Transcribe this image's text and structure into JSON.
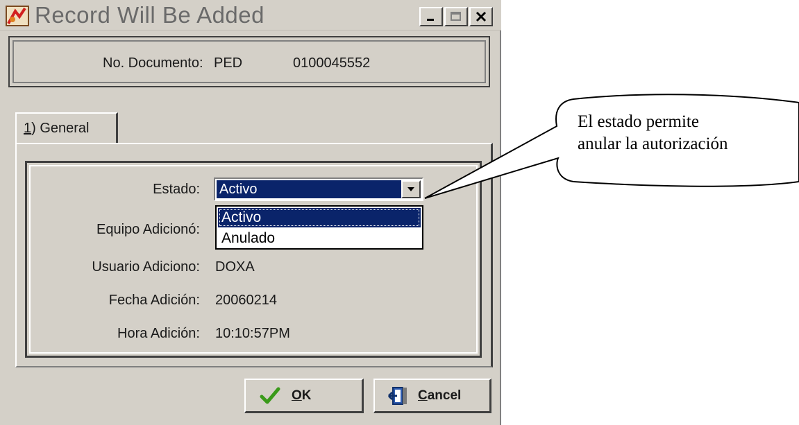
{
  "window": {
    "title": "Record Will Be Added"
  },
  "document": {
    "label": "No. Documento:",
    "prefix": "PED",
    "number": "0100045552"
  },
  "tabs": [
    {
      "mnemonic": "1",
      "rest": ") General",
      "active": true
    }
  ],
  "fields": {
    "estado": {
      "label": "Estado:",
      "value": "Activo"
    },
    "equipo": {
      "label": "Equipo Adicionó:"
    },
    "usuario": {
      "label": "Usuario Adiciono:",
      "value": "DOXA"
    },
    "fecha": {
      "label": "Fecha Adición:",
      "value": "20060214"
    },
    "hora": {
      "label": "Hora Adición:",
      "value": "10:10:57PM"
    }
  },
  "dropdown": {
    "options": [
      "Activo",
      "Anulado"
    ],
    "selected_index": 0
  },
  "buttons": {
    "ok": {
      "mnemonic": "O",
      "rest": "K"
    },
    "cancel": {
      "mnemonic": "C",
      "rest": "ancel"
    }
  },
  "callout": {
    "line1": "El estado permite",
    "line2": "anular la autorización"
  },
  "colors": {
    "face": "#d4d0c8",
    "selection": "#0a246a",
    "ok_check": "#3a9a1a"
  }
}
